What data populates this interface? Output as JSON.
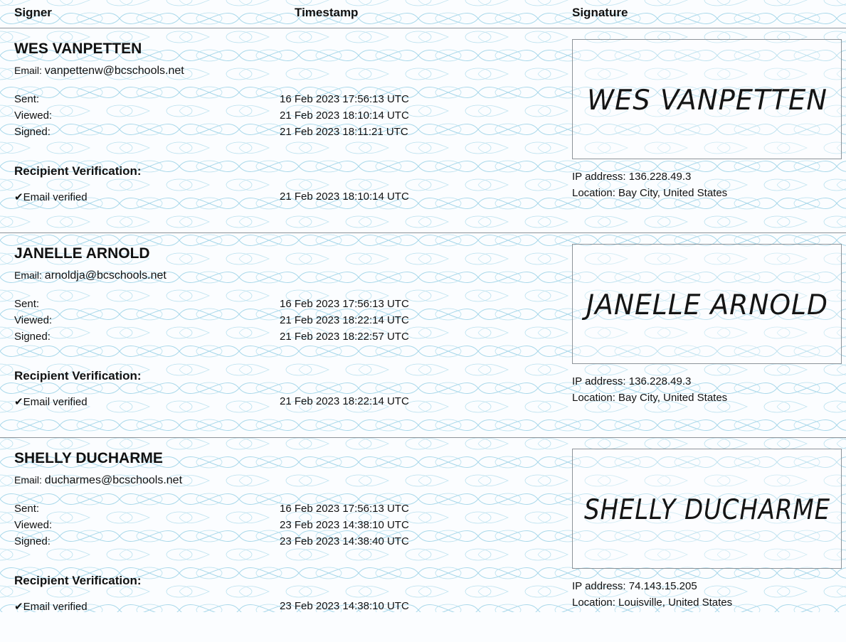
{
  "header": {
    "signer": "Signer",
    "timestamp": "Timestamp",
    "signature": "Signature"
  },
  "labels": {
    "email": "Email: ",
    "sent": "Sent:",
    "viewed": "Viewed:",
    "signed": "Signed:",
    "recipient_verification": "Recipient Verification:",
    "email_verified": "✔Email verified"
  },
  "colors": {
    "background": "#fbfdff",
    "pattern": "#9ed2e6",
    "rule": "#8d9399"
  },
  "signers": [
    {
      "name": "WES VANPETTEN",
      "email": "vanpettenw@bcschools.net",
      "sent": "16 Feb 2023 17:56:13 UTC",
      "viewed": "21 Feb 2023 18:10:14 UTC",
      "signed": "21 Feb 2023 18:11:21 UTC",
      "email_verified": "21 Feb 2023 18:10:14 UTC",
      "signature_text": "WES VANPETTEN",
      "ip": "IP address: 136.228.49.3",
      "location": "Location: Bay City, United States"
    },
    {
      "name": "JANELLE ARNOLD",
      "email": "arnoldja@bcschools.net",
      "sent": "16 Feb 2023 17:56:13 UTC",
      "viewed": "21 Feb 2023 18:22:14 UTC",
      "signed": "21 Feb 2023 18:22:57 UTC",
      "email_verified": "21 Feb 2023 18:22:14 UTC",
      "signature_text": "JANELLE ARNOLD",
      "ip": "IP address: 136.228.49.3",
      "location": "Location: Bay City, United States"
    },
    {
      "name": "SHELLY DUCHARME",
      "email": "ducharmes@bcschools.net",
      "sent": "16 Feb 2023 17:56:13 UTC",
      "viewed": "23 Feb 2023 14:38:10 UTC",
      "signed": "23 Feb 2023 14:38:40 UTC",
      "email_verified": "23 Feb 2023 14:38:10 UTC",
      "signature_text": "SHELLY DUCHARME",
      "ip": "IP address: 74.143.15.205",
      "location": "Location: Louisville, United States"
    }
  ]
}
